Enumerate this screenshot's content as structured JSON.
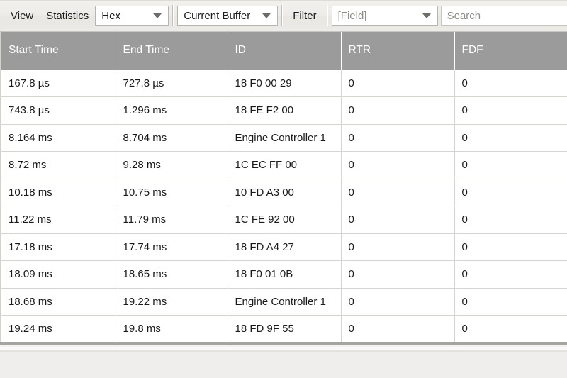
{
  "toolbar": {
    "view_label": "View",
    "statistics_label": "Statistics",
    "format_combo": {
      "value": "Hex",
      "icon": "chevron-down-icon"
    },
    "buffer_combo": {
      "value": "Current Buffer",
      "icon": "chevron-down-icon"
    },
    "filter_label": "Filter",
    "field_combo": {
      "value": "[Field]",
      "icon": "chevron-down-icon"
    },
    "search_input": {
      "value": "",
      "placeholder": "Search"
    }
  },
  "table": {
    "columns": [
      "Start Time",
      "End Time",
      "ID",
      "RTR",
      "FDF"
    ],
    "rows": [
      [
        "167.8 µs",
        "727.8 µs",
        "18 F0 00 29",
        "0",
        "0"
      ],
      [
        "743.8 µs",
        "1.296 ms",
        "18 FE F2 00",
        "0",
        "0"
      ],
      [
        "8.164 ms",
        "8.704 ms",
        "Engine Controller 1",
        "0",
        "0"
      ],
      [
        "8.72 ms",
        "9.28 ms",
        "1C EC FF 00",
        "0",
        "0"
      ],
      [
        "10.18 ms",
        "10.75 ms",
        "10 FD A3 00",
        "0",
        "0"
      ],
      [
        "11.22 ms",
        "11.79 ms",
        "1C FE 92 00",
        "0",
        "0"
      ],
      [
        "17.18 ms",
        "17.74 ms",
        "18 FD A4 27",
        "0",
        "0"
      ],
      [
        "18.09 ms",
        "18.65 ms",
        "18 F0 01 0B",
        "0",
        "0"
      ],
      [
        "18.68 ms",
        "19.22 ms",
        "Engine Controller 1",
        "0",
        "0"
      ],
      [
        "19.24 ms",
        "19.8 ms",
        "18 FD 9F 55",
        "0",
        "0"
      ]
    ]
  },
  "colors": {
    "header_background": "#9b9b9b",
    "header_text": "#ffffff",
    "toolbar_background": "#eeece8",
    "grid_line": "#d6d4d0",
    "cell_text": "#1a1a1a",
    "placeholder_text": "#8e8c88"
  }
}
